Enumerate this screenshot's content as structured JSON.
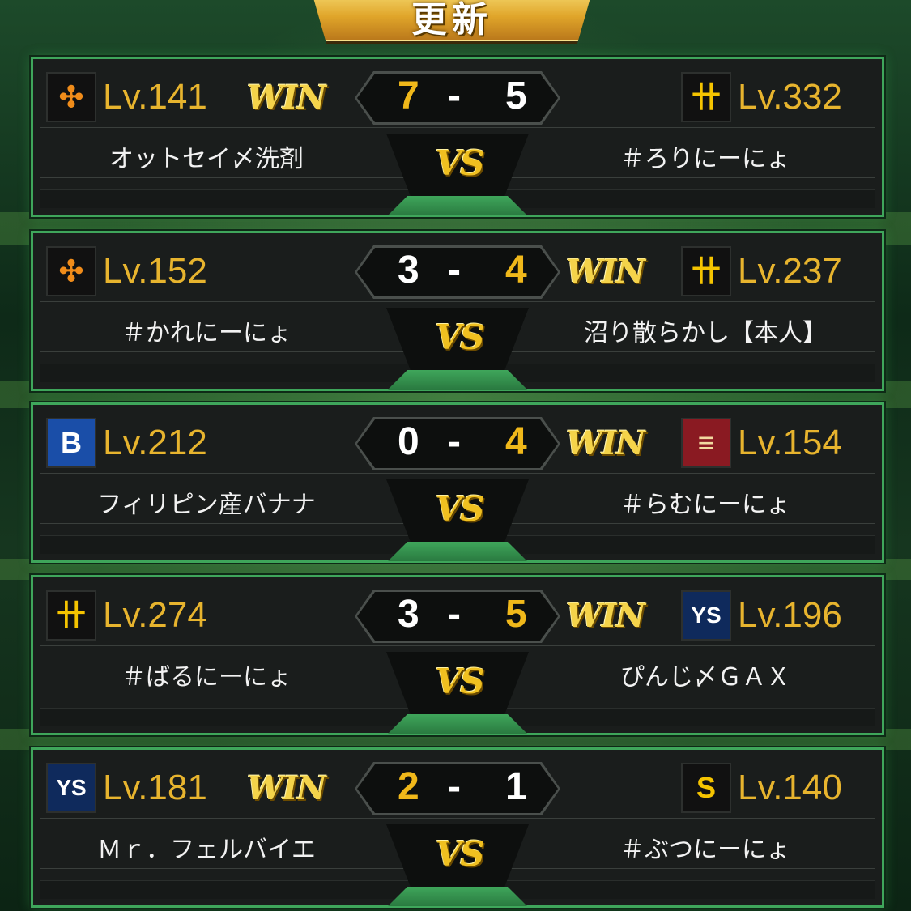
{
  "header": {
    "update_label": "更新"
  },
  "colors": {
    "winner_score": "#f0b81a",
    "loser_score": "#ffffff",
    "level": "#e7b42e",
    "frame": "#3fa65b"
  },
  "matches": [
    {
      "left": {
        "team_icon": "giants-logo-icon",
        "level": "Lv.141",
        "name": "オットセイ〆洗剤",
        "score": "7",
        "win": true
      },
      "right": {
        "team_icon": "tigers-logo-icon",
        "level": "Lv.332",
        "name": "＃ろりにーにょ",
        "score": "5",
        "win": false
      },
      "win_label": "WIN",
      "vs_label": "VS",
      "dash": "-"
    },
    {
      "left": {
        "team_icon": "giants-logo-icon",
        "level": "Lv.152",
        "name": "＃かれにーにょ",
        "score": "3",
        "win": false
      },
      "right": {
        "team_icon": "tigers-logo-icon",
        "level": "Lv.237",
        "name": "沼り散らかし【本人】",
        "score": "4",
        "win": true
      },
      "win_label": "WIN",
      "vs_label": "VS",
      "dash": "-"
    },
    {
      "left": {
        "team_icon": "baystars-logo-icon",
        "level": "Lv.212",
        "name": "フィリピン産バナナ",
        "score": "0",
        "win": false
      },
      "right": {
        "team_icon": "eagles-logo-icon",
        "level": "Lv.154",
        "name": "＃らむにーにょ",
        "score": "4",
        "win": true
      },
      "win_label": "WIN",
      "vs_label": "VS",
      "dash": "-"
    },
    {
      "left": {
        "team_icon": "tigers-logo-icon",
        "level": "Lv.274",
        "name": "＃ばるにーにょ",
        "score": "3",
        "win": false
      },
      "right": {
        "team_icon": "swallows-logo-icon",
        "level": "Lv.196",
        "name": "ぴんじ〆ＧＡＸ",
        "score": "5",
        "win": true
      },
      "win_label": "WIN",
      "vs_label": "VS",
      "dash": "-"
    },
    {
      "left": {
        "team_icon": "swallows-logo-icon",
        "level": "Lv.181",
        "name": "Ｍｒ．フェルバイエ",
        "score": "2",
        "win": true
      },
      "right": {
        "team_icon": "hawks-logo-icon",
        "level": "Lv.140",
        "name": "＃ぶつにーにょ",
        "score": "1",
        "win": false
      },
      "win_label": "WIN",
      "vs_label": "VS",
      "dash": "-"
    }
  ]
}
